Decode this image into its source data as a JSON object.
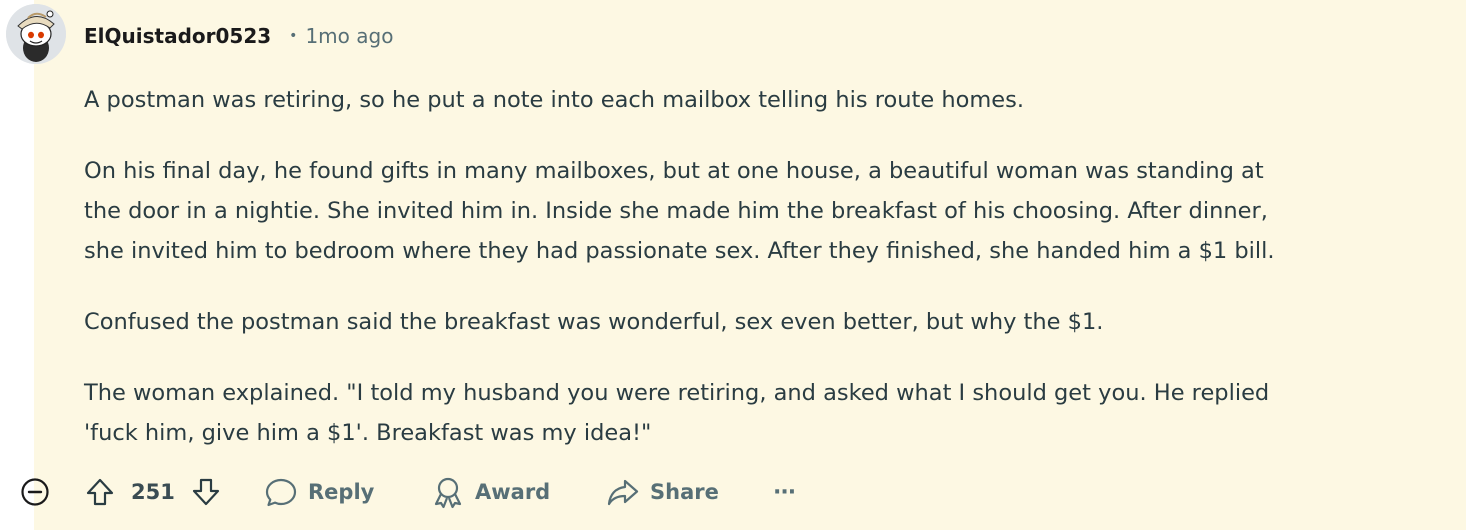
{
  "comment": {
    "username": "ElQuistador0523",
    "separator": "•",
    "timestamp": "1mo ago",
    "paragraphs": [
      [
        "A postman was retiring, so he put a note into each mailbox telling his route homes."
      ],
      [
        "On his final day, he found gifts in many mailboxes, but at one house, a beautiful woman was standing at",
        "the door in a nightie. She invited him in. Inside she made him the breakfast of his choosing. After dinner,",
        "she invited him to bedroom where they had passionate sex. After they finished, she handed him a $1 bill."
      ],
      [
        "Confused the postman said the breakfast was wonderful, sex even better, but why the $1."
      ],
      [
        "The woman explained. \"I told my husband you were retiring, and asked what I should get you. He replied",
        "'fuck him, give him a $1'. Breakfast was my idea!\""
      ]
    ]
  },
  "actions": {
    "score": "251",
    "reply_label": "Reply",
    "award_label": "Award",
    "share_label": "Share",
    "more_label": "···"
  },
  "icons": {
    "collapse": "minus-circle-icon",
    "upvote": "upvote-arrow-icon",
    "downvote": "downvote-arrow-icon",
    "reply": "speech-bubble-icon",
    "award": "award-ribbon-icon",
    "share": "share-arrow-icon"
  },
  "colors": {
    "background": "#fdf8e3",
    "text": "#2a3c42",
    "muted": "#576f76"
  }
}
